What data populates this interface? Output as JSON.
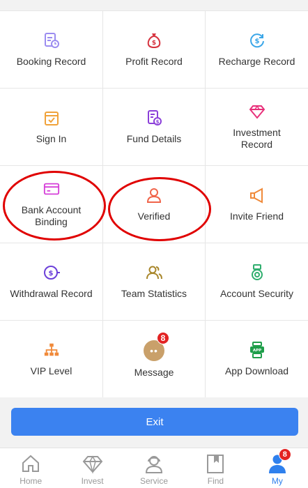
{
  "grid": [
    {
      "label": "Booking Record",
      "icon": "booking-record-icon"
    },
    {
      "label": "Profit Record",
      "icon": "money-bag-icon"
    },
    {
      "label": "Recharge Record",
      "icon": "recharge-coin-icon"
    },
    {
      "label": "Sign In",
      "icon": "sign-in-checkbox-icon"
    },
    {
      "label": "Fund Details",
      "icon": "fund-details-icon"
    },
    {
      "label": "Investment\nRecord",
      "icon": "diamond-icon"
    },
    {
      "label": "Bank Account Binding",
      "icon": "bank-card-icon"
    },
    {
      "label": "Verified",
      "icon": "person-icon"
    },
    {
      "label": "Invite Friend",
      "icon": "megaphone-icon"
    },
    {
      "label": "Withdrawal Record",
      "icon": "withdraw-coin-icon"
    },
    {
      "label": "Team Statistics",
      "icon": "team-icon"
    },
    {
      "label": "Account Security",
      "icon": "medal-icon"
    },
    {
      "label": "VIP Level",
      "icon": "hierarchy-icon"
    },
    {
      "label": "Message",
      "icon": "chat-bubble-icon",
      "badge": "8"
    },
    {
      "label": "App Download",
      "icon": "app-download-icon"
    }
  ],
  "exit_label": "Exit",
  "tabs": [
    {
      "label": "Home",
      "icon": "home-icon"
    },
    {
      "label": "Invest",
      "icon": "diamond-outline-icon"
    },
    {
      "label": "Service",
      "icon": "service-agent-icon"
    },
    {
      "label": "Find",
      "icon": "bookmark-icon"
    },
    {
      "label": "My",
      "icon": "user-icon",
      "badge": "8",
      "active": true
    }
  ],
  "colors": {
    "accent": "#3b82f0",
    "active_tab": "#2f80ed",
    "badge": "#e32222",
    "annotation": "#e00000"
  }
}
